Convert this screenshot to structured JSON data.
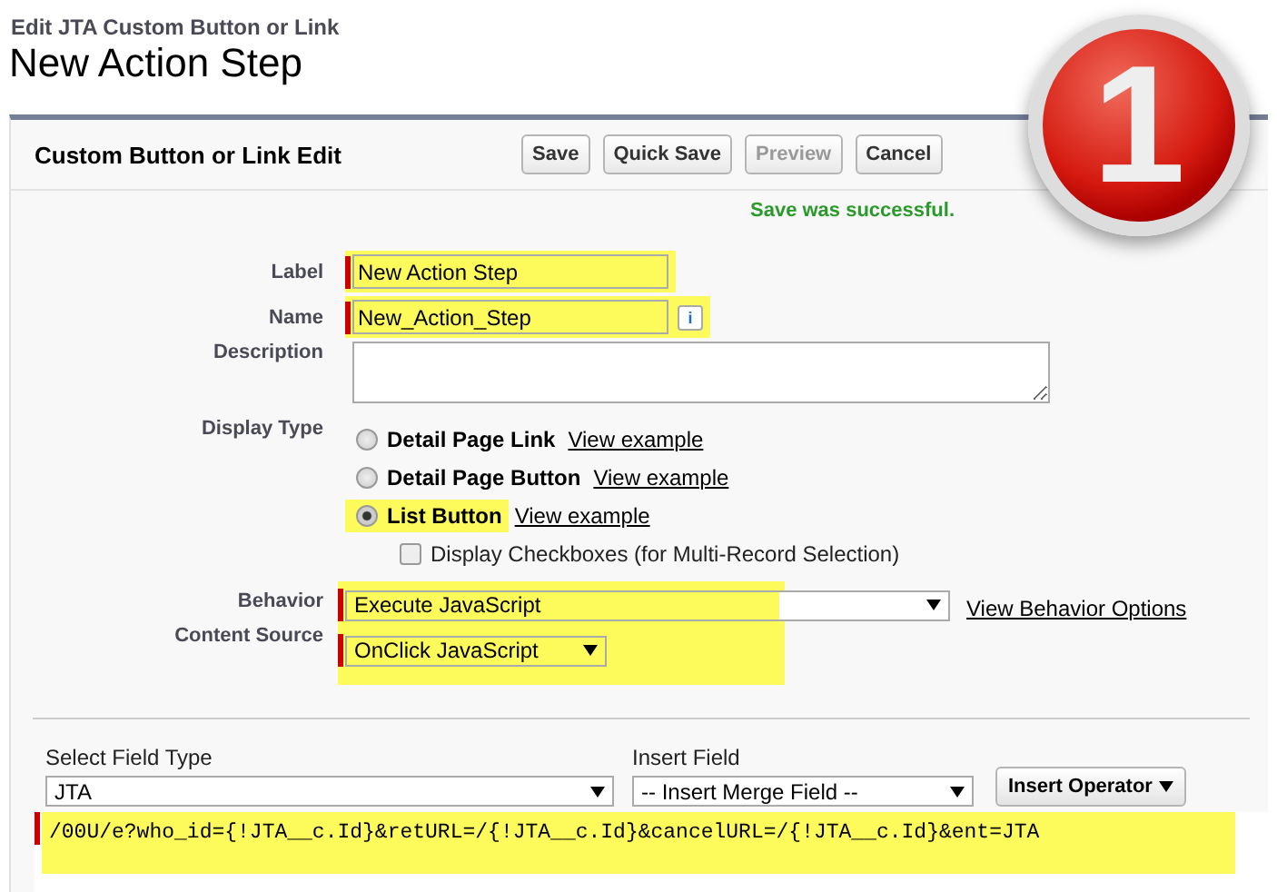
{
  "breadcrumb": "Edit JTA Custom Button or Link",
  "title": "New Action Step",
  "badge": "1",
  "panel": {
    "title": "Custom Button or Link Edit",
    "buttons": [
      {
        "label": "Save",
        "disabled": false
      },
      {
        "label": "Quick Save",
        "disabled": false
      },
      {
        "label": "Preview",
        "disabled": true
      },
      {
        "label": "Cancel",
        "disabled": false
      }
    ],
    "message": "Save was successful."
  },
  "fields": [
    {
      "kind": "text",
      "label": "Label",
      "value": "New Action Step",
      "required": true,
      "highlighted": true
    },
    {
      "kind": "text",
      "label": "Name",
      "value": "New_Action_Step",
      "required": true,
      "highlighted": true,
      "info": "i"
    },
    {
      "kind": "textarea",
      "label": "Description"
    }
  ],
  "display_type": {
    "label": "Display Type",
    "options": [
      {
        "label": "Detail Page Link",
        "link": "View example",
        "selected": false,
        "highlighted": false
      },
      {
        "label": "Detail Page Button",
        "link": "View example",
        "selected": false,
        "highlighted": false
      },
      {
        "label": "List Button",
        "link": "View example",
        "selected": true,
        "highlighted": true
      }
    ],
    "checkbox": {
      "label": "Display Checkboxes (for Multi-Record Selection)",
      "checked": false
    }
  },
  "behavior": {
    "label": "Behavior",
    "value": "Execute JavaScript",
    "link": "View Behavior Options"
  },
  "content_source": {
    "label": "Content Source",
    "value": "OnClick JavaScript"
  },
  "editor": {
    "field_type": {
      "label": "Select Field Type",
      "value": "JTA"
    },
    "insert_field": {
      "label": "Insert Field",
      "value": "-- Insert Merge Field --"
    },
    "operator": "Insert Operator",
    "code": "/00U/e?who_id={!JTA__c.Id}&retURL=/{!JTA__c.Id}&cancelURL=/{!JTA__c.Id}&ent=JTA"
  }
}
